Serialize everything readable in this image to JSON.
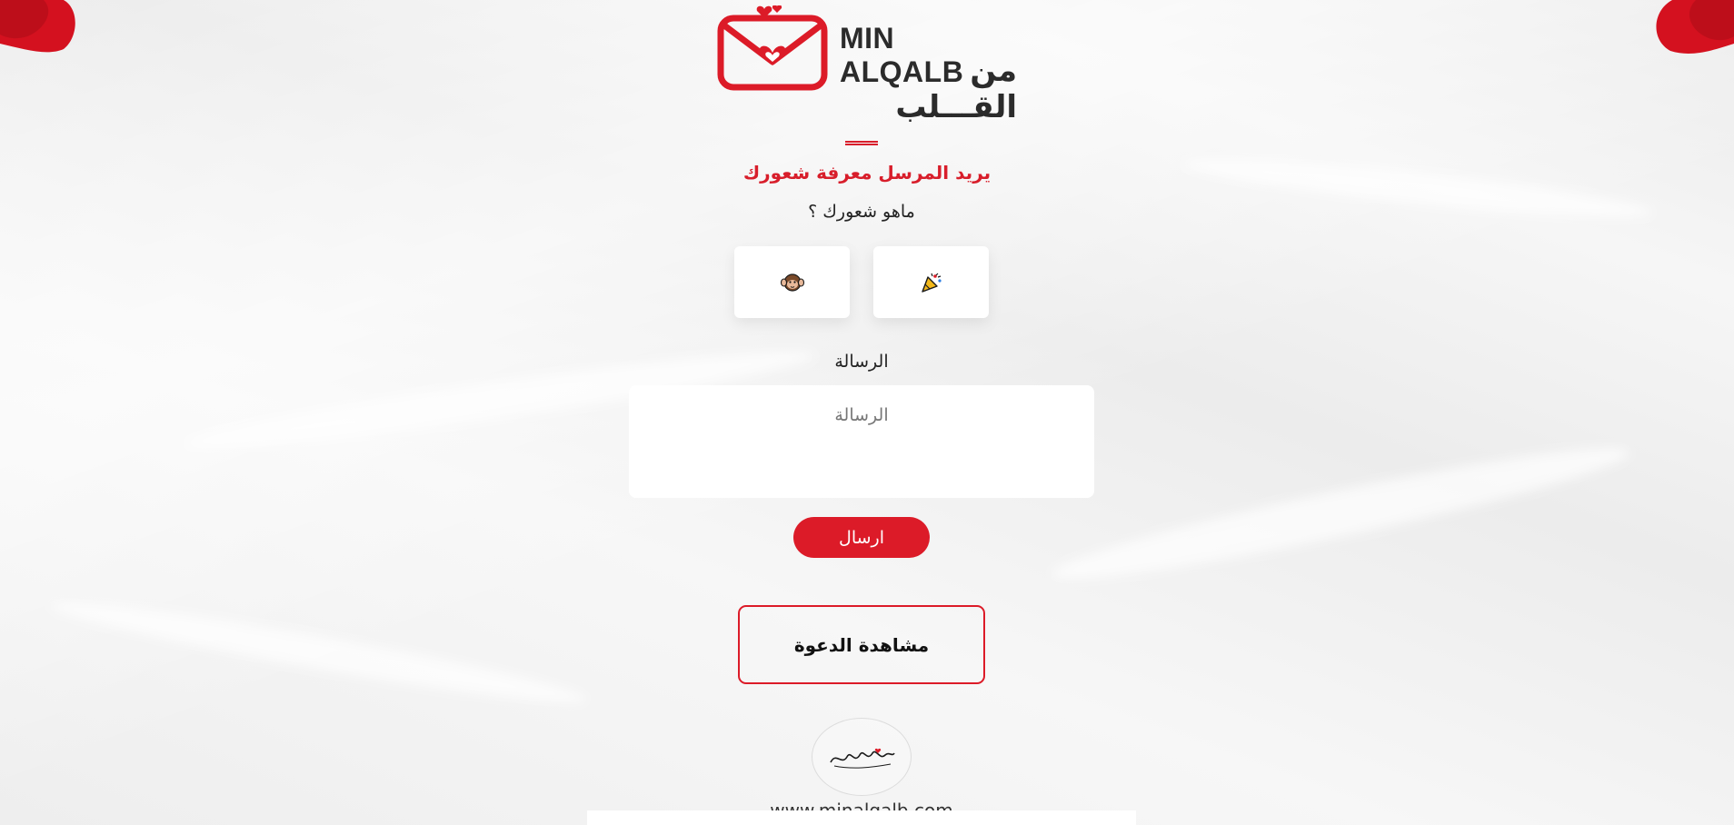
{
  "brand": {
    "name_en": "MIN ALQALB",
    "name_ar": "من القـــلب",
    "accent_color": "#dc1b28",
    "logo_icon": "envelope-heart-icon"
  },
  "prompt": {
    "heading": "يريد المرسل معرفة شعورك",
    "question": "ماهو شعورك ؟"
  },
  "reactions": [
    {
      "icon": "party-popper-icon"
    },
    {
      "icon": "hear-no-evil-monkey-icon"
    }
  ],
  "message": {
    "label": "الرسالة",
    "placeholder": "الرسالة",
    "value": ""
  },
  "actions": {
    "send_label": "ارسال",
    "view_invitation_label": "مشاهدة الدعوة"
  },
  "footer": {
    "signature_icon": "calligraphy-signature-icon",
    "url": "www.minalqalb.com"
  }
}
